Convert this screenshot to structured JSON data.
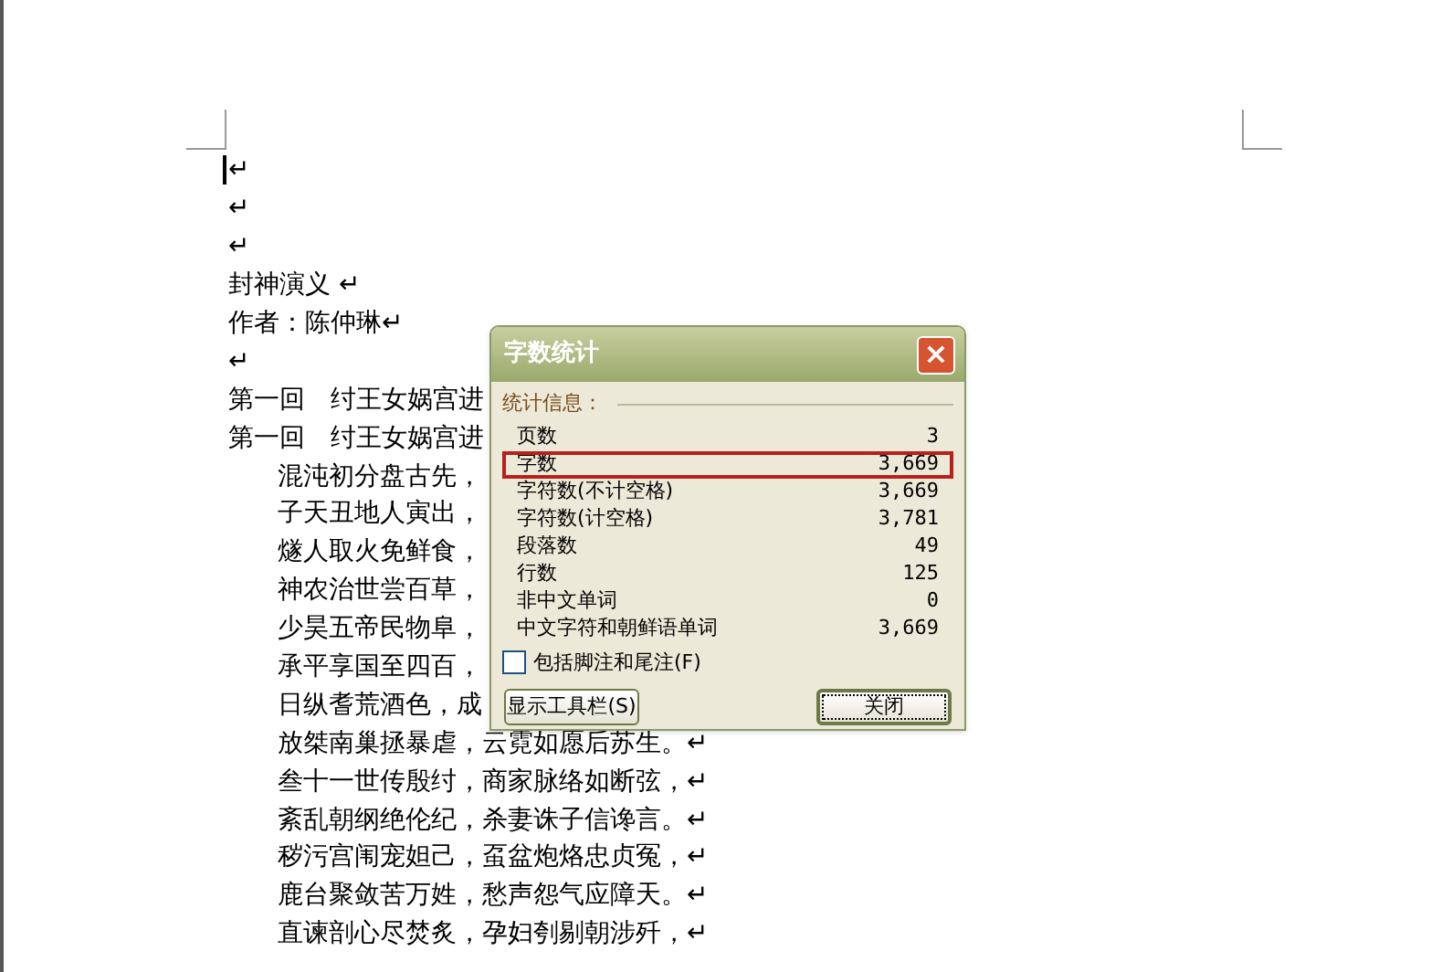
{
  "document": {
    "lines": [
      {
        "text": "↵",
        "indent": false,
        "cursor": true
      },
      {
        "text": "↵",
        "indent": false,
        "cursor": false
      },
      {
        "text": "↵",
        "indent": false,
        "cursor": false
      },
      {
        "text": "封神演义 ↵",
        "indent": false,
        "cursor": false
      },
      {
        "text": "作者：陈仲琳↵",
        "indent": false,
        "cursor": false
      },
      {
        "text": "↵",
        "indent": false,
        "cursor": false
      },
      {
        "text": "第一回　纣王女娲宫进",
        "indent": false,
        "cursor": false
      },
      {
        "text": "第一回　纣王女娲宫进",
        "indent": false,
        "cursor": false
      },
      {
        "text": "混沌初分盘古先，",
        "indent": true,
        "cursor": false
      },
      {
        "text": "子天丑地人寅出，",
        "indent": true,
        "cursor": false
      },
      {
        "text": "燧人取火免鲜食，",
        "indent": true,
        "cursor": false
      },
      {
        "text": "神农治世尝百草，",
        "indent": true,
        "cursor": false
      },
      {
        "text": "少昊五帝民物阜，",
        "indent": true,
        "cursor": false
      },
      {
        "text": "承平享国至四百，",
        "indent": true,
        "cursor": false
      },
      {
        "text": "日纵耆荒酒色，成",
        "indent": true,
        "cursor": false
      },
      {
        "text": "放桀南巢拯暴虐，云霓如愿后苏生。↵",
        "indent": true,
        "cursor": false
      },
      {
        "text": "叁十一世传殷纣，商家脉络如断弦，↵",
        "indent": true,
        "cursor": false
      },
      {
        "text": "紊乱朝纲绝伦纪，杀妻诛子信谗言。↵",
        "indent": true,
        "cursor": false
      },
      {
        "text": "秽污宫闱宠妲己，虿盆炮烙忠贞冤，↵",
        "indent": true,
        "cursor": false
      },
      {
        "text": "鹿台聚敛苦万姓，愁声怨气应障天。↵",
        "indent": true,
        "cursor": false
      },
      {
        "text": "直谏剖心尽焚炙，孕妇刳剔朝涉歼，↵",
        "indent": true,
        "cursor": false
      }
    ]
  },
  "dialog": {
    "title": "字数统计",
    "close": "×",
    "section": "统计信息：",
    "rows": [
      {
        "label": "页数",
        "value": "3",
        "selected": false
      },
      {
        "label": "字数",
        "value": "3,669",
        "selected": true
      },
      {
        "label": "字符数(不计空格)",
        "value": "3,669",
        "selected": false
      },
      {
        "label": "字符数(计空格)",
        "value": "3,781",
        "selected": false
      },
      {
        "label": "段落数",
        "value": "49",
        "selected": false
      },
      {
        "label": "行数",
        "value": "125",
        "selected": false
      },
      {
        "label": "非中文单词",
        "value": "0",
        "selected": false
      },
      {
        "label": "中文字符和朝鲜语单词",
        "value": "3,669",
        "selected": false
      }
    ],
    "checkbox": {
      "label": "包括脚注和尾注(F)",
      "checked": false
    },
    "buttons": [
      {
        "label": "显示工具栏(S)",
        "default": false
      },
      {
        "label": "关闭",
        "default": true
      }
    ]
  }
}
